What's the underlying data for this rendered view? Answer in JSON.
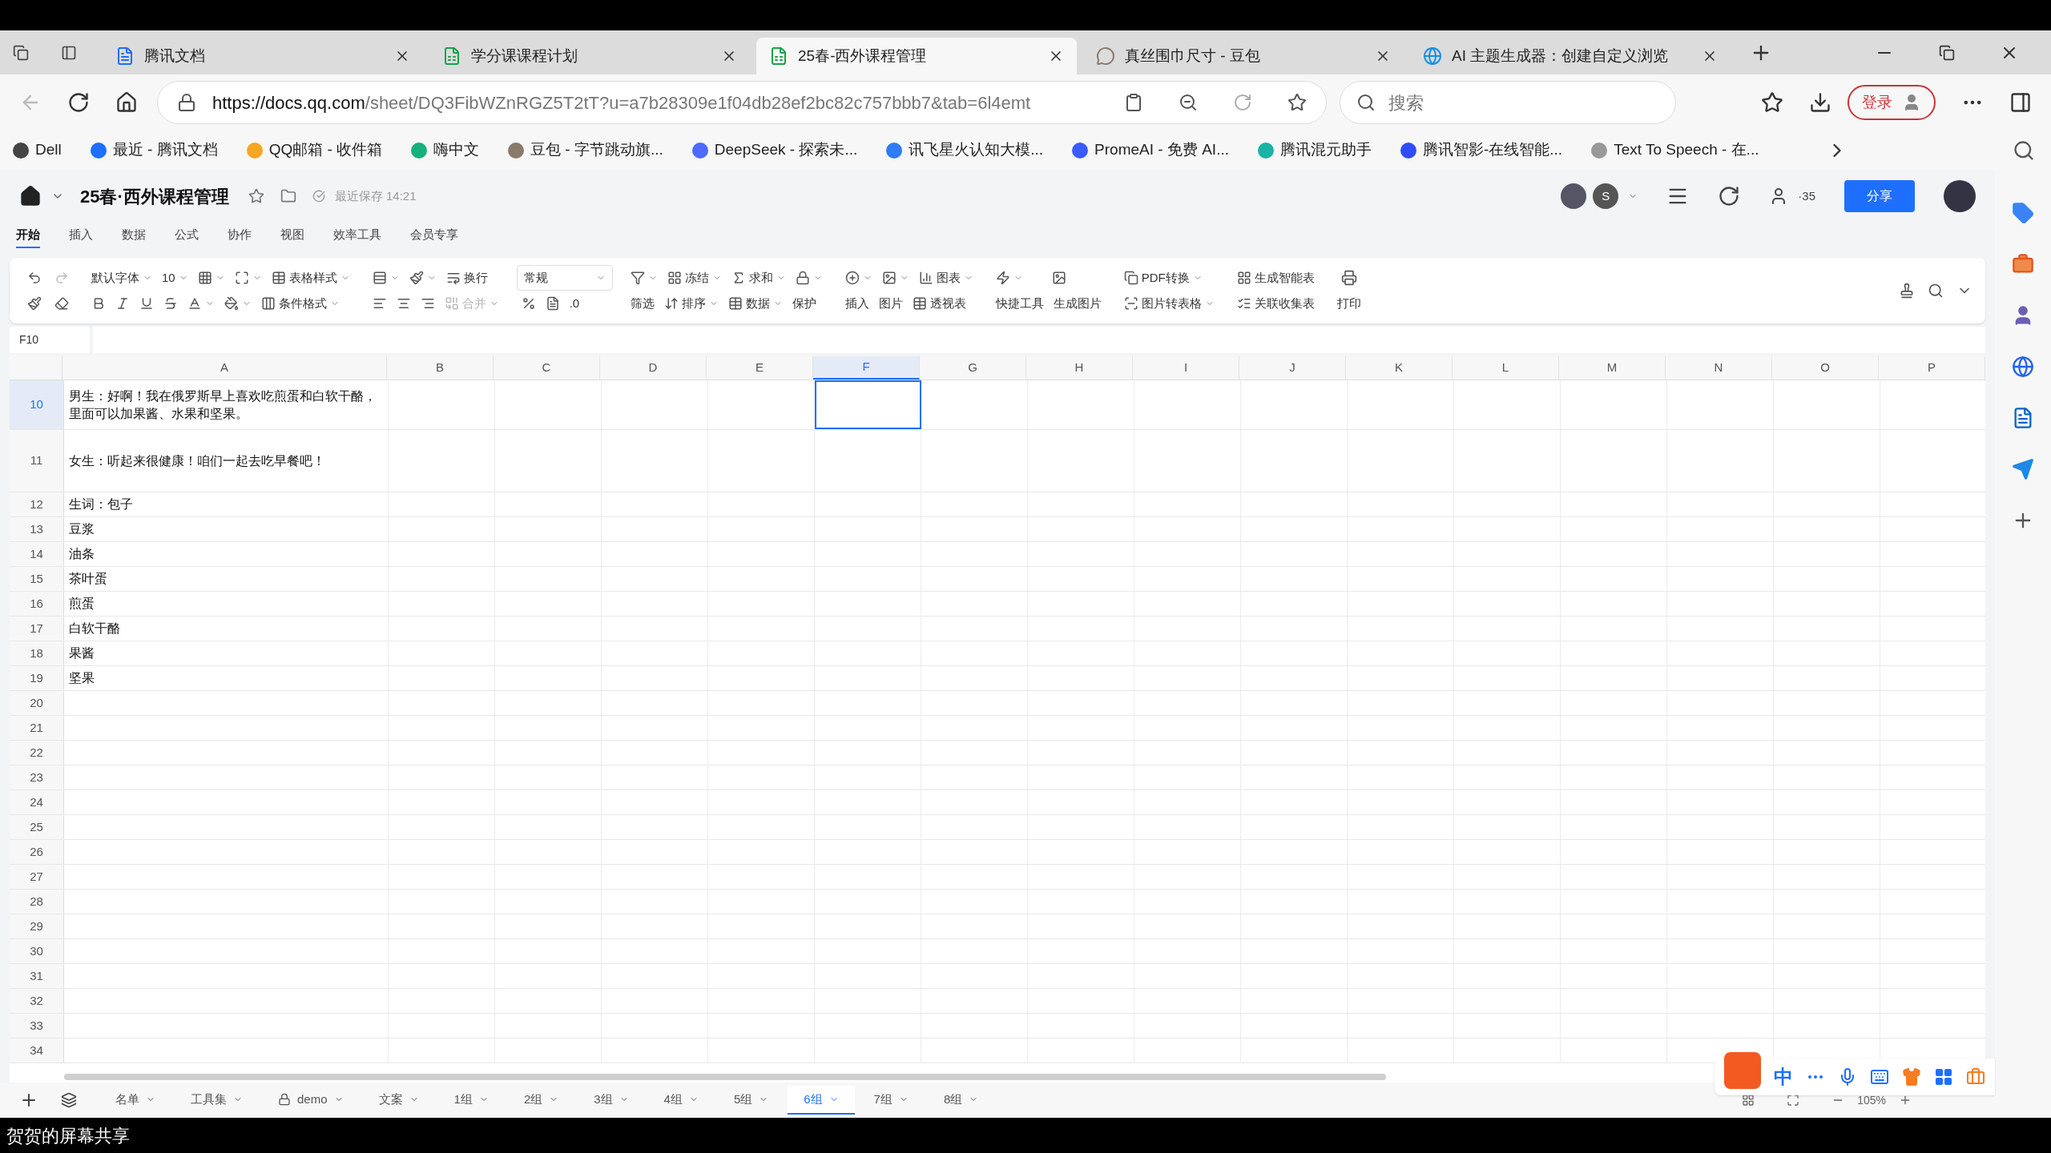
{
  "browser_tabs": [
    {
      "title": "腾讯文档",
      "selected": false,
      "kind": "docs"
    },
    {
      "title": "学分课课程计划",
      "selected": false,
      "kind": "sheet"
    },
    {
      "title": "25春-西外课程管理",
      "selected": true,
      "kind": "sheet"
    },
    {
      "title": "真丝围巾尺寸 - 豆包",
      "selected": false,
      "kind": "chat"
    },
    {
      "title": "AI 主题生成器：创建自定义浏览",
      "selected": false,
      "kind": "edge"
    }
  ],
  "address_bar": {
    "url_host": "https://docs.qq.com",
    "url_path": "/sheet/DQ3FibWZnRGZ5T2tT?u=a7b28309e1f04db28ef2bc82c757bbb7&tab=6l4emt",
    "search_placeholder": "搜索",
    "login": "登录"
  },
  "bookmarks": [
    {
      "label": "Dell",
      "color": "#444444"
    },
    {
      "label": "最近 - 腾讯文档",
      "color": "#1e6fff"
    },
    {
      "label": "QQ邮箱 - 收件箱",
      "color": "#f5a623"
    },
    {
      "label": "嗨中文",
      "color": "#16b07c"
    },
    {
      "label": "豆包 - 字节跳动旗...",
      "color": "#8a7a6a"
    },
    {
      "label": "DeepSeek - 探索未...",
      "color": "#4d6bfe"
    },
    {
      "label": "讯飞星火认知大模...",
      "color": "#2f7cf6"
    },
    {
      "label": "PromeAI - 免费 AI...",
      "color": "#3b5bff"
    },
    {
      "label": "腾讯混元助手",
      "color": "#19b3a6"
    },
    {
      "label": "腾讯智影-在线智能...",
      "color": "#2f4cff"
    },
    {
      "label": "Text To Speech - 在...",
      "color": "#999999"
    }
  ],
  "document": {
    "title": "25春·西外课程管理",
    "save_status": "最近保存 14:21",
    "collaborator": "S",
    "viewer_count": "·35",
    "share": "分享"
  },
  "menu_tabs": [
    {
      "label": "开始",
      "selected": true
    },
    {
      "label": "插入",
      "selected": false
    },
    {
      "label": "数据",
      "selected": false
    },
    {
      "label": "公式",
      "selected": false
    },
    {
      "label": "协作",
      "selected": false
    },
    {
      "label": "视图",
      "selected": false
    },
    {
      "label": "效率工具",
      "selected": false
    },
    {
      "label": "会员专享",
      "selected": false
    }
  ],
  "toolbar": {
    "font": "默认字体",
    "font_size": "10",
    "table_style": "表格样式",
    "conditional_format": "条件格式",
    "wrap": "换行",
    "merge": "合并",
    "number_format": "常规",
    "decimal": ".0",
    "freeze": "冻结",
    "sum": "求和",
    "filter": "筛选",
    "sort": "排序",
    "data": "数据",
    "protect": "保护",
    "insert": "插入",
    "picture": "图片",
    "chart": "图表",
    "pivot": "透视表",
    "quick_tools": "快捷工具",
    "generate_image": "生成图片",
    "pdf": "PDF转换",
    "image_to_table": "图片转表格",
    "smart_table": "生成智能表",
    "collect_table": "关联收集表",
    "print": "打印"
  },
  "name_box": "F10",
  "columns": [
    {
      "label": "A",
      "selected": false
    },
    {
      "label": "B",
      "selected": false
    },
    {
      "label": "C",
      "selected": false
    },
    {
      "label": "D",
      "selected": false
    },
    {
      "label": "E",
      "selected": false
    },
    {
      "label": "F",
      "selected": true
    },
    {
      "label": "G",
      "selected": false
    },
    {
      "label": "H",
      "selected": false
    },
    {
      "label": "I",
      "selected": false
    },
    {
      "label": "J",
      "selected": false
    },
    {
      "label": "K",
      "selected": false
    },
    {
      "label": "L",
      "selected": false
    },
    {
      "label": "M",
      "selected": false
    },
    {
      "label": "N",
      "selected": false
    },
    {
      "label": "O",
      "selected": false
    },
    {
      "label": "P",
      "selected": false
    }
  ],
  "rows": [
    {
      "number": "10",
      "cell_a": "男生：好啊！我在俄罗斯早上喜欢吃煎蛋和白软干酪，里面可以加果酱、水果和坚果。",
      "selected": true
    },
    {
      "number": "11",
      "cell_a": "女生：听起来很健康！咱们一起去吃早餐吧！",
      "selected": false
    },
    {
      "number": "12",
      "cell_a": "生词：包子",
      "selected": false
    },
    {
      "number": "13",
      "cell_a": "豆浆",
      "selected": false
    },
    {
      "number": "14",
      "cell_a": "油条",
      "selected": false
    },
    {
      "number": "15",
      "cell_a": "茶叶蛋",
      "selected": false
    },
    {
      "number": "16",
      "cell_a": "煎蛋",
      "selected": false
    },
    {
      "number": "17",
      "cell_a": "白软干酪",
      "selected": false
    },
    {
      "number": "18",
      "cell_a": "果酱",
      "selected": false
    },
    {
      "number": "19",
      "cell_a": "坚果",
      "selected": false
    },
    {
      "number": "20",
      "selected": false
    },
    {
      "number": "21",
      "selected": false
    },
    {
      "number": "22",
      "selected": false
    },
    {
      "number": "23",
      "selected": false
    },
    {
      "number": "24",
      "selected": false
    },
    {
      "number": "25",
      "selected": false
    },
    {
      "number": "26",
      "selected": false
    },
    {
      "number": "27",
      "selected": false
    },
    {
      "number": "28",
      "selected": false
    },
    {
      "number": "29",
      "selected": false
    },
    {
      "number": "30",
      "selected": false
    },
    {
      "number": "31",
      "selected": false
    },
    {
      "number": "32",
      "selected": false
    },
    {
      "number": "33",
      "selected": false
    },
    {
      "number": "34",
      "selected": false
    }
  ],
  "sheet_tabs": [
    {
      "label": "名单",
      "selected": false,
      "kind": "plain"
    },
    {
      "label": "工具集",
      "selected": false,
      "kind": "plain"
    },
    {
      "label": "demo",
      "selected": false,
      "kind": "locked"
    },
    {
      "label": "文案",
      "selected": false,
      "kind": "plain"
    },
    {
      "label": "1组",
      "selected": false,
      "kind": "plain"
    },
    {
      "label": "2组",
      "selected": false,
      "kind": "plain"
    },
    {
      "label": "3组",
      "selected": false,
      "kind": "plain"
    },
    {
      "label": "4组",
      "selected": false,
      "kind": "plain"
    },
    {
      "label": "5组",
      "selected": false,
      "kind": "plain"
    },
    {
      "label": "6组",
      "selected": true,
      "kind": "plain"
    },
    {
      "label": "7组",
      "selected": false,
      "kind": "plain"
    },
    {
      "label": "8组",
      "selected": false,
      "kind": "plain"
    }
  ],
  "zoom": "105%",
  "ime_mode": "中",
  "screen_share_label": "贺贺的屏幕共享"
}
